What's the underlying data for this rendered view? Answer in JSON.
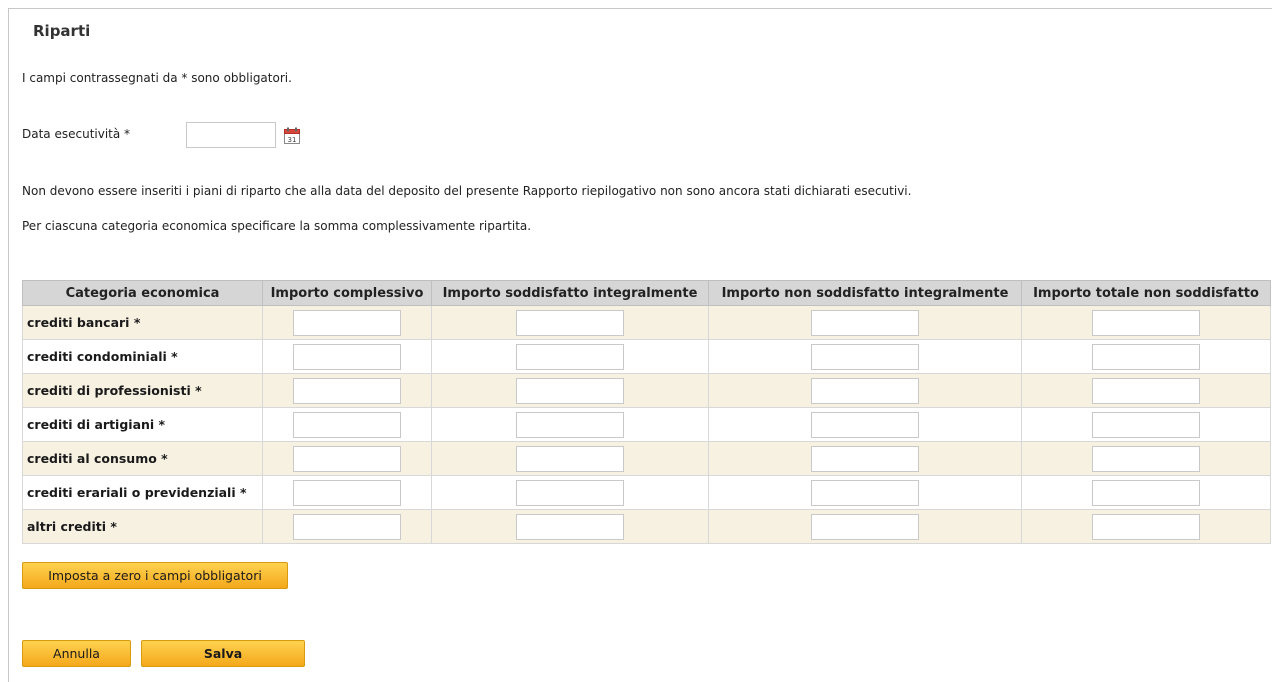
{
  "page": {
    "title": "Riparti",
    "required_note": "I campi contrassegnati da * sono obbligatori.",
    "notice_1": "Non devono essere inseriti i piani di riparto che alla data del deposito del presente Rapporto riepilogativo non sono ancora stati dichiarati esecutivi.",
    "notice_2": "Per ciascuna categoria economica specificare la somma complessivamente ripartita."
  },
  "date_field": {
    "label": "Data esecutività *",
    "value": "",
    "icon": "calendar-icon"
  },
  "table": {
    "headers": [
      "Categoria economica",
      "Importo complessivo",
      "Importo soddisfatto integralmente",
      "Importo non soddisfatto integralmente",
      "Importo totale non soddisfatto"
    ],
    "rows": [
      {
        "category": "crediti bancari *",
        "values": [
          "",
          "",
          "",
          ""
        ]
      },
      {
        "category": "crediti condominiali *",
        "values": [
          "",
          "",
          "",
          ""
        ]
      },
      {
        "category": "crediti di professionisti *",
        "values": [
          "",
          "",
          "",
          ""
        ]
      },
      {
        "category": "crediti di artigiani *",
        "values": [
          "",
          "",
          "",
          ""
        ]
      },
      {
        "category": "crediti al consumo *",
        "values": [
          "",
          "",
          "",
          ""
        ]
      },
      {
        "category": "crediti erariali o previdenziali *",
        "values": [
          "",
          "",
          "",
          ""
        ]
      },
      {
        "category": "altri crediti *",
        "values": [
          "",
          "",
          "",
          ""
        ]
      }
    ]
  },
  "buttons": {
    "zero_label": "Imposta a zero i campi obbligatori",
    "cancel_label": "Annulla",
    "save_label": "Salva"
  },
  "colors": {
    "button_accent": "#f4a81c",
    "row_alt": "#f7f1e2",
    "header_bg": "#d6d6d6"
  }
}
